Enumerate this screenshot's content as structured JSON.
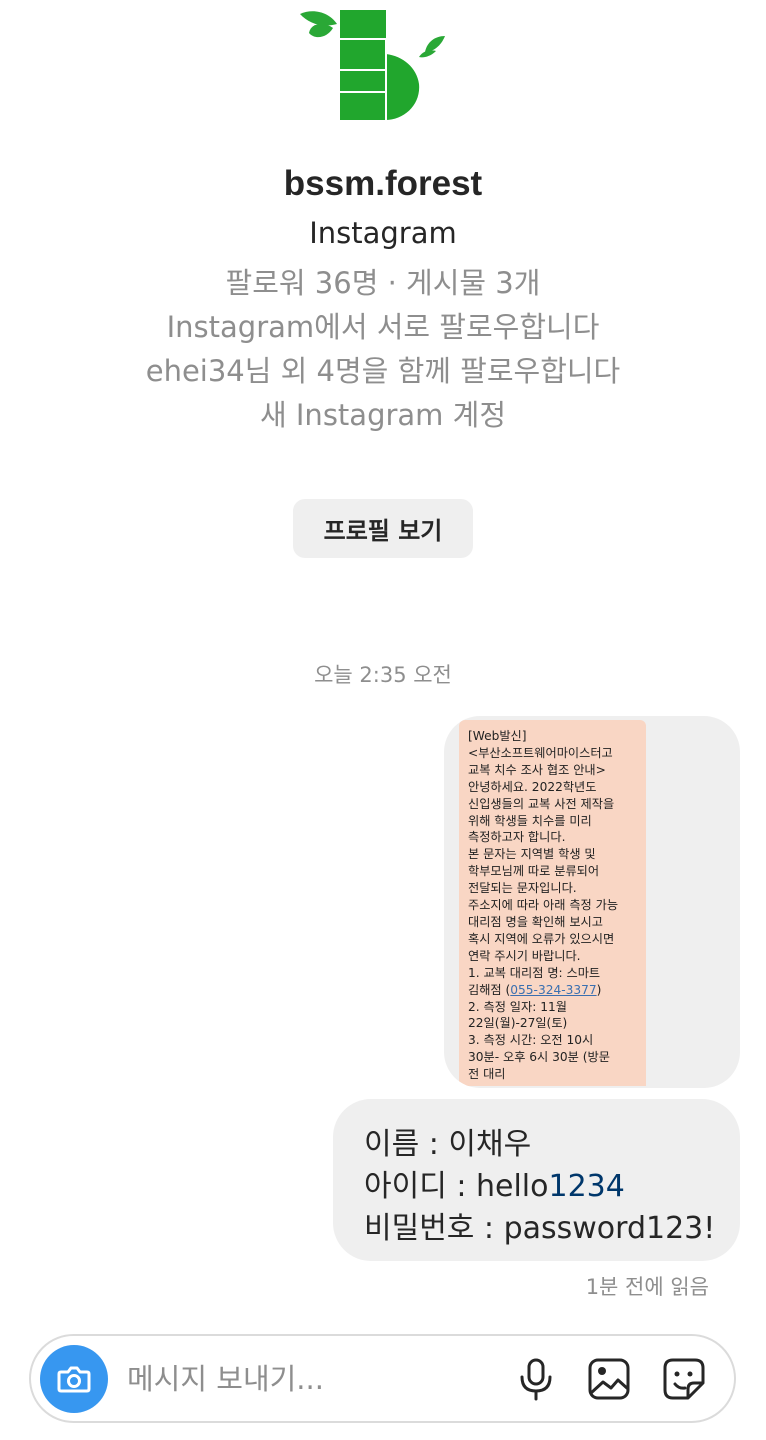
{
  "profile": {
    "name": "bssm.forest",
    "subtitle": "Instagram",
    "stats": "팔로워 36명 · 게시물 3개",
    "mutual_note": "Instagram에서 서로 팔로우합니다",
    "followed_by": "ehei34님 외 4명을 함께 팔로우합니다",
    "account_note": "새 Instagram 계정",
    "view_profile_label": "프로필 보기",
    "logo_icon": "bssm-forest-logo",
    "logo_color": "#22a832"
  },
  "thread": {
    "timestamp": "오늘 2:35 오전",
    "image_message": {
      "lines_before_phone": "[Web발신]\n<부산소프트웨어마이스터고\n교복 치수 조사 협조 안내>\n안녕하세요. 2022학년도\n신입생들의 교복 사전 제작을\n위해 학생들 치수를 미리\n측정하고자 합니다.\n본 문자는 지역별 학생 및\n학부모님께 따로 분류되어\n전달되는 문자입니다.\n주소지에 따라 아래 측정 가능\n대리점 명을 확인해 보시고\n혹시 지역에 오류가 있으시면\n연락 주시기 바랍니다.\n1. 교복 대리점 명: 스마트\n김해점 (",
      "phone": "055-324-3377",
      "lines_after_phone": ")\n2. 측정 일자: 11월\n22일(월)-27일(토)\n3. 측정 시간: 오전 10시\n30분- 오후 6시 30분 (방문\n전 대리",
      "card_color": "#f9d6c4"
    },
    "text_message": {
      "line1": "이름 : 이채우",
      "line2_prefix": "아이디 : hello",
      "line2_link": "1234",
      "line3": "비밀번호 : password123!"
    },
    "read_receipt": "1분 전에 읽음"
  },
  "composer": {
    "placeholder": "메시지 보내기...",
    "camera_icon": "camera-icon",
    "mic_icon": "microphone-icon",
    "gallery_icon": "gallery-icon",
    "sticker_icon": "sticker-icon",
    "accent_color": "#3797f0"
  }
}
